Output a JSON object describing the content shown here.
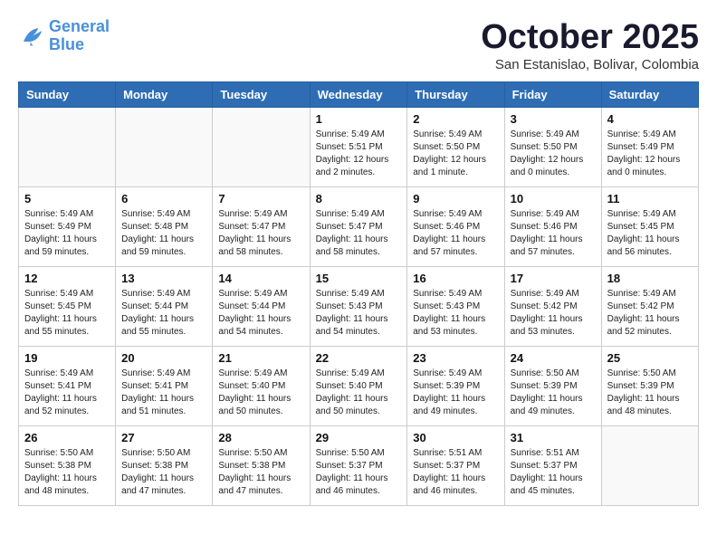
{
  "logo": {
    "line1": "General",
    "line2": "Blue"
  },
  "title": "October 2025",
  "subtitle": "San Estanislao, Bolivar, Colombia",
  "days_header": [
    "Sunday",
    "Monday",
    "Tuesday",
    "Wednesday",
    "Thursday",
    "Friday",
    "Saturday"
  ],
  "weeks": [
    [
      {
        "day": "",
        "info": ""
      },
      {
        "day": "",
        "info": ""
      },
      {
        "day": "",
        "info": ""
      },
      {
        "day": "1",
        "info": "Sunrise: 5:49 AM\nSunset: 5:51 PM\nDaylight: 12 hours\nand 2 minutes."
      },
      {
        "day": "2",
        "info": "Sunrise: 5:49 AM\nSunset: 5:50 PM\nDaylight: 12 hours\nand 1 minute."
      },
      {
        "day": "3",
        "info": "Sunrise: 5:49 AM\nSunset: 5:50 PM\nDaylight: 12 hours\nand 0 minutes."
      },
      {
        "day": "4",
        "info": "Sunrise: 5:49 AM\nSunset: 5:49 PM\nDaylight: 12 hours\nand 0 minutes."
      }
    ],
    [
      {
        "day": "5",
        "info": "Sunrise: 5:49 AM\nSunset: 5:49 PM\nDaylight: 11 hours\nand 59 minutes."
      },
      {
        "day": "6",
        "info": "Sunrise: 5:49 AM\nSunset: 5:48 PM\nDaylight: 11 hours\nand 59 minutes."
      },
      {
        "day": "7",
        "info": "Sunrise: 5:49 AM\nSunset: 5:47 PM\nDaylight: 11 hours\nand 58 minutes."
      },
      {
        "day": "8",
        "info": "Sunrise: 5:49 AM\nSunset: 5:47 PM\nDaylight: 11 hours\nand 58 minutes."
      },
      {
        "day": "9",
        "info": "Sunrise: 5:49 AM\nSunset: 5:46 PM\nDaylight: 11 hours\nand 57 minutes."
      },
      {
        "day": "10",
        "info": "Sunrise: 5:49 AM\nSunset: 5:46 PM\nDaylight: 11 hours\nand 57 minutes."
      },
      {
        "day": "11",
        "info": "Sunrise: 5:49 AM\nSunset: 5:45 PM\nDaylight: 11 hours\nand 56 minutes."
      }
    ],
    [
      {
        "day": "12",
        "info": "Sunrise: 5:49 AM\nSunset: 5:45 PM\nDaylight: 11 hours\nand 55 minutes."
      },
      {
        "day": "13",
        "info": "Sunrise: 5:49 AM\nSunset: 5:44 PM\nDaylight: 11 hours\nand 55 minutes."
      },
      {
        "day": "14",
        "info": "Sunrise: 5:49 AM\nSunset: 5:44 PM\nDaylight: 11 hours\nand 54 minutes."
      },
      {
        "day": "15",
        "info": "Sunrise: 5:49 AM\nSunset: 5:43 PM\nDaylight: 11 hours\nand 54 minutes."
      },
      {
        "day": "16",
        "info": "Sunrise: 5:49 AM\nSunset: 5:43 PM\nDaylight: 11 hours\nand 53 minutes."
      },
      {
        "day": "17",
        "info": "Sunrise: 5:49 AM\nSunset: 5:42 PM\nDaylight: 11 hours\nand 53 minutes."
      },
      {
        "day": "18",
        "info": "Sunrise: 5:49 AM\nSunset: 5:42 PM\nDaylight: 11 hours\nand 52 minutes."
      }
    ],
    [
      {
        "day": "19",
        "info": "Sunrise: 5:49 AM\nSunset: 5:41 PM\nDaylight: 11 hours\nand 52 minutes."
      },
      {
        "day": "20",
        "info": "Sunrise: 5:49 AM\nSunset: 5:41 PM\nDaylight: 11 hours\nand 51 minutes."
      },
      {
        "day": "21",
        "info": "Sunrise: 5:49 AM\nSunset: 5:40 PM\nDaylight: 11 hours\nand 50 minutes."
      },
      {
        "day": "22",
        "info": "Sunrise: 5:49 AM\nSunset: 5:40 PM\nDaylight: 11 hours\nand 50 minutes."
      },
      {
        "day": "23",
        "info": "Sunrise: 5:49 AM\nSunset: 5:39 PM\nDaylight: 11 hours\nand 49 minutes."
      },
      {
        "day": "24",
        "info": "Sunrise: 5:50 AM\nSunset: 5:39 PM\nDaylight: 11 hours\nand 49 minutes."
      },
      {
        "day": "25",
        "info": "Sunrise: 5:50 AM\nSunset: 5:39 PM\nDaylight: 11 hours\nand 48 minutes."
      }
    ],
    [
      {
        "day": "26",
        "info": "Sunrise: 5:50 AM\nSunset: 5:38 PM\nDaylight: 11 hours\nand 48 minutes."
      },
      {
        "day": "27",
        "info": "Sunrise: 5:50 AM\nSunset: 5:38 PM\nDaylight: 11 hours\nand 47 minutes."
      },
      {
        "day": "28",
        "info": "Sunrise: 5:50 AM\nSunset: 5:38 PM\nDaylight: 11 hours\nand 47 minutes."
      },
      {
        "day": "29",
        "info": "Sunrise: 5:50 AM\nSunset: 5:37 PM\nDaylight: 11 hours\nand 46 minutes."
      },
      {
        "day": "30",
        "info": "Sunrise: 5:51 AM\nSunset: 5:37 PM\nDaylight: 11 hours\nand 46 minutes."
      },
      {
        "day": "31",
        "info": "Sunrise: 5:51 AM\nSunset: 5:37 PM\nDaylight: 11 hours\nand 45 minutes."
      },
      {
        "day": "",
        "info": ""
      }
    ]
  ]
}
